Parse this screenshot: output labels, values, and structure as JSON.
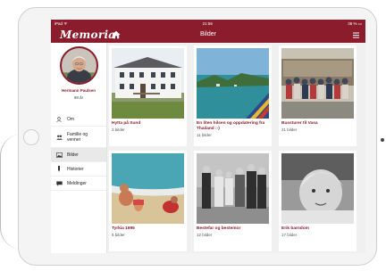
{
  "device": {
    "status_left": "iPad ᯤ",
    "status_time": "21:56",
    "status_right": "36 % ▭"
  },
  "app": {
    "logo": "Memoria",
    "title": "Bilder"
  },
  "profile": {
    "name": "Hermann Paulsen",
    "age": "98 år"
  },
  "menu": [
    {
      "label": "Om",
      "icon": "person-icon"
    },
    {
      "label": "Familie og venner",
      "icon": "people-icon"
    },
    {
      "label": "Bilder",
      "icon": "photo-icon"
    },
    {
      "label": "Historier",
      "icon": "pen-icon"
    },
    {
      "label": "Meldinger",
      "icon": "message-icon"
    }
  ],
  "albums": [
    {
      "title": "Hytta på Sund",
      "count": "3 bilder"
    },
    {
      "title": "En liten hilsen og oppdatering fra Thailand :-)",
      "count": "11 bilder"
    },
    {
      "title": "Bussturer til Vasa",
      "count": "21 bilder"
    },
    {
      "title": "Tyrkia 1995",
      "count": "5 bilder"
    },
    {
      "title": "Bestefar og bestemor",
      "count": "12 bilder"
    },
    {
      "title": "Erik barndom",
      "count": "17 bilder"
    }
  ],
  "colors": {
    "brand": "#8b1c2c",
    "background": "#f0f0f0"
  }
}
